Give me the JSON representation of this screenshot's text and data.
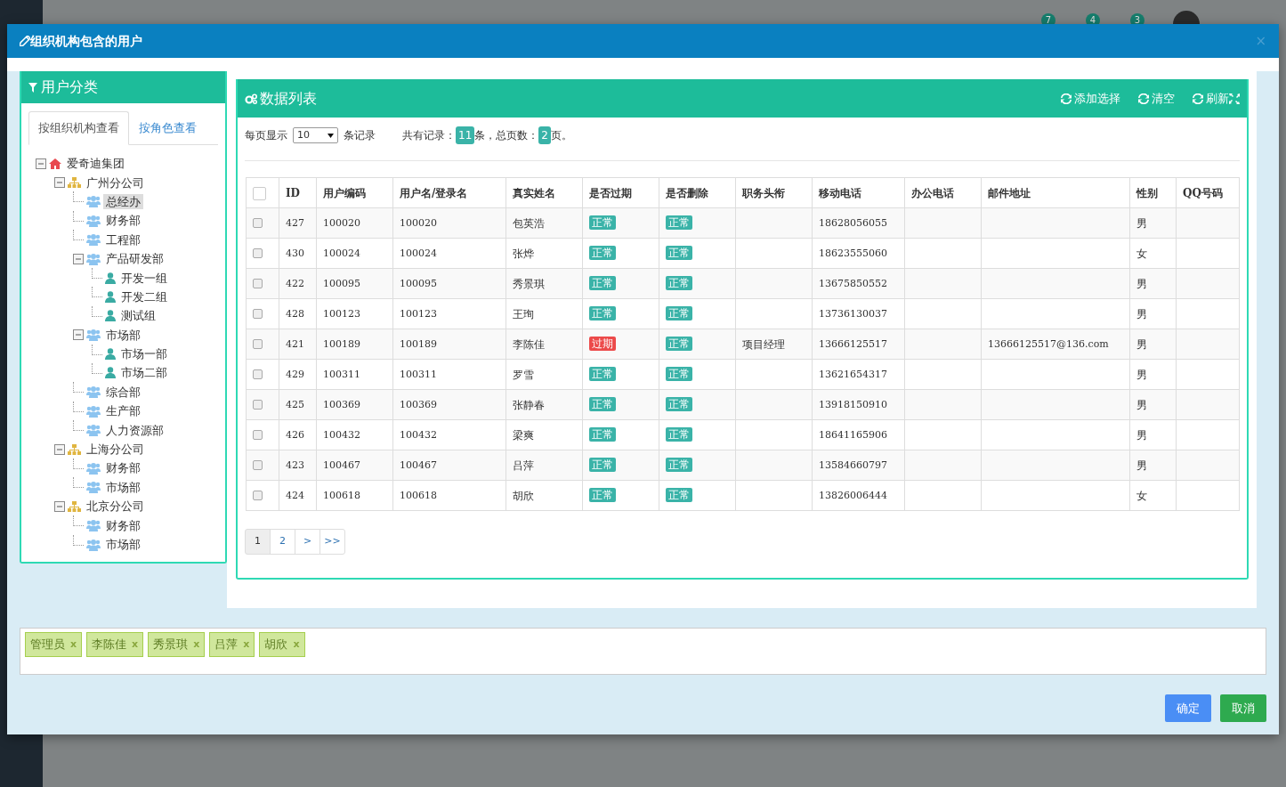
{
  "background": {
    "notifications": [
      "7",
      "4",
      "3"
    ]
  },
  "modal": {
    "title": "组织机构包含的用户",
    "close": "×"
  },
  "category_panel": {
    "title": "用户分类",
    "tabs": [
      {
        "label": "按组织机构查看",
        "selected": true
      },
      {
        "label": "按角色查看",
        "selected": false
      }
    ],
    "tree": [
      {
        "label": "爱奇迪集团",
        "kind": "home",
        "expanded": true,
        "selected": false,
        "children": [
          {
            "label": "广州分公司",
            "kind": "org",
            "expanded": true,
            "selected": false,
            "children": [
              {
                "label": "总经办",
                "kind": "dept",
                "selected": true
              },
              {
                "label": "财务部",
                "kind": "dept",
                "selected": false
              },
              {
                "label": "工程部",
                "kind": "dept",
                "selected": false
              },
              {
                "label": "产品研发部",
                "kind": "dept",
                "expanded": true,
                "selected": false,
                "children": [
                  {
                    "label": "开发一组",
                    "kind": "group",
                    "selected": false
                  },
                  {
                    "label": "开发二组",
                    "kind": "group",
                    "selected": false
                  },
                  {
                    "label": "测试组",
                    "kind": "group",
                    "selected": false
                  }
                ]
              },
              {
                "label": "市场部",
                "kind": "dept",
                "expanded": true,
                "selected": false,
                "children": [
                  {
                    "label": "市场一部",
                    "kind": "group",
                    "selected": false
                  },
                  {
                    "label": "市场二部",
                    "kind": "group",
                    "selected": false
                  }
                ]
              },
              {
                "label": "综合部",
                "kind": "dept",
                "selected": false
              },
              {
                "label": "生产部",
                "kind": "dept",
                "selected": false
              },
              {
                "label": "人力资源部",
                "kind": "dept",
                "selected": false
              }
            ]
          },
          {
            "label": "上海分公司",
            "kind": "org",
            "expanded": true,
            "selected": false,
            "children": [
              {
                "label": "财务部",
                "kind": "dept",
                "selected": false
              },
              {
                "label": "市场部",
                "kind": "dept",
                "selected": false
              }
            ]
          },
          {
            "label": "北京分公司",
            "kind": "org",
            "expanded": true,
            "selected": false,
            "children": [
              {
                "label": "财务部",
                "kind": "dept",
                "selected": false
              },
              {
                "label": "市场部",
                "kind": "dept",
                "selected": false
              }
            ]
          }
        ]
      }
    ]
  },
  "data_panel": {
    "title": "数据列表",
    "tools": [
      "添加选择",
      "清空",
      "刷新"
    ],
    "page_size_label": "每页显示",
    "page_size": "10",
    "page_size_suffix": "条记录",
    "total_label": "共有记录：",
    "total": "11",
    "pages_label": "条，总页数：",
    "pages": "2",
    "pages_suffix": "页。",
    "table": {
      "select_all_checked": false,
      "columns": [
        "ID",
        "用户编码",
        "用户名/登录名",
        "真实姓名",
        "是否过期",
        "是否删除",
        "职务头衔",
        "移动电话",
        "办公电话",
        "邮件地址",
        "性别",
        "QQ号码"
      ],
      "rows": [
        {
          "checked": false,
          "id": "427",
          "code": "100020",
          "username": "100020",
          "name": "包英浩",
          "expired": {
            "text": "正常",
            "on": false
          },
          "deleted": {
            "text": "正常",
            "on": false
          },
          "mobile": "18628056055",
          "gender": "男"
        },
        {
          "checked": false,
          "id": "430",
          "code": "100024",
          "username": "100024",
          "name": "张烨",
          "expired": {
            "text": "正常",
            "on": false
          },
          "deleted": {
            "text": "正常",
            "on": false
          },
          "mobile": "18623555060",
          "gender": "女"
        },
        {
          "checked": false,
          "id": "422",
          "code": "100095",
          "username": "100095",
          "name": "秀景琪",
          "expired": {
            "text": "正常",
            "on": false
          },
          "deleted": {
            "text": "正常",
            "on": false
          },
          "mobile": "13675850552",
          "gender": "男"
        },
        {
          "checked": false,
          "id": "428",
          "code": "100123",
          "username": "100123",
          "name": "王珣",
          "expired": {
            "text": "正常",
            "on": false
          },
          "deleted": {
            "text": "正常",
            "on": false
          },
          "mobile": "13736130037",
          "gender": "男"
        },
        {
          "checked": false,
          "id": "421",
          "code": "100189",
          "username": "100189",
          "name": "李陈佳",
          "expired": {
            "text": "过期",
            "on": true
          },
          "deleted": {
            "text": "正常",
            "on": false
          },
          "title": "项目经理",
          "mobile": "13666125517",
          "email": "13666125517@136.com",
          "gender": "男"
        },
        {
          "checked": false,
          "id": "429",
          "code": "100311",
          "username": "100311",
          "name": "罗雪",
          "expired": {
            "text": "正常",
            "on": false
          },
          "deleted": {
            "text": "正常",
            "on": false
          },
          "mobile": "13621654317",
          "gender": "男"
        },
        {
          "checked": false,
          "id": "425",
          "code": "100369",
          "username": "100369",
          "name": "张静春",
          "expired": {
            "text": "正常",
            "on": false
          },
          "deleted": {
            "text": "正常",
            "on": false
          },
          "mobile": "13918150910",
          "gender": "男"
        },
        {
          "checked": false,
          "id": "426",
          "code": "100432",
          "username": "100432",
          "name": "梁爽",
          "expired": {
            "text": "正常",
            "on": false
          },
          "deleted": {
            "text": "正常",
            "on": false
          },
          "mobile": "18641165906",
          "gender": "男"
        },
        {
          "checked": false,
          "id": "423",
          "code": "100467",
          "username": "100467",
          "name": "吕萍",
          "expired": {
            "text": "正常",
            "on": false
          },
          "deleted": {
            "text": "正常",
            "on": false
          },
          "mobile": "13584660797",
          "gender": "男"
        },
        {
          "checked": false,
          "id": "424",
          "code": "100618",
          "username": "100618",
          "name": "胡欣",
          "expired": {
            "text": "正常",
            "on": false
          },
          "deleted": {
            "text": "正常",
            "on": false
          },
          "mobile": "13826006444",
          "gender": "女"
        }
      ]
    },
    "pagination": [
      {
        "label": "1",
        "selected": true
      },
      {
        "label": "2",
        "selected": false
      },
      {
        "label": ">",
        "selected": false
      },
      {
        "label": ">>",
        "selected": false
      }
    ]
  },
  "selected_users": [
    {
      "label": "管理员",
      "remove": "x"
    },
    {
      "label": "李陈佳",
      "remove": "x"
    },
    {
      "label": "秀景琪",
      "remove": "x"
    },
    {
      "label": "吕萍",
      "remove": "x"
    },
    {
      "label": "胡欣",
      "remove": "x"
    }
  ],
  "buttons": [
    {
      "label": "确定",
      "kind": "primary"
    },
    {
      "label": "取消",
      "kind": "success"
    }
  ]
}
